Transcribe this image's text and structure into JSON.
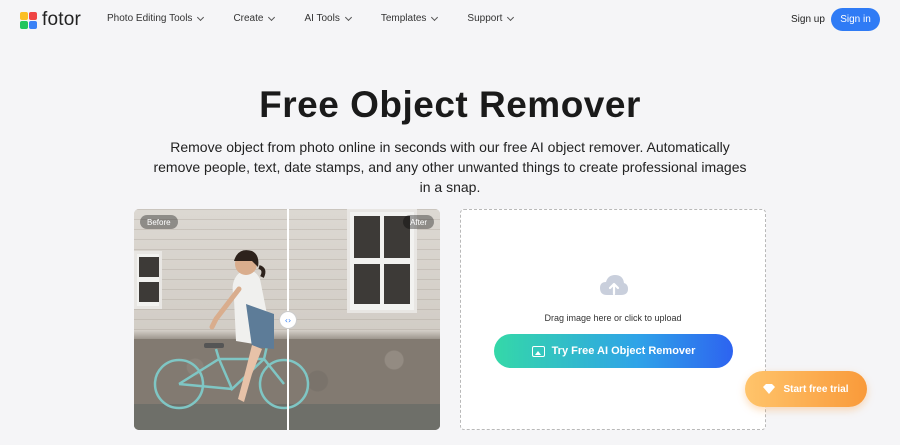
{
  "nav": {
    "logo_text": "fotor",
    "menu": [
      {
        "label": "Photo Editing Tools"
      },
      {
        "label": "Create"
      },
      {
        "label": "AI Tools"
      },
      {
        "label": "Templates"
      },
      {
        "label": "Support"
      }
    ],
    "signup_label": "Sign up",
    "signin_label": "Sign in"
  },
  "hero": {
    "title": "Free Object Remover",
    "subtitle": "Remove object from photo online in seconds with our free AI object remover. Automatically remove people, text, date stamps, and any other unwanted things to create professional images in a snap."
  },
  "compare": {
    "before_label": "Before",
    "after_label": "After",
    "handle_icon": "arrows-left-right-icon"
  },
  "upload": {
    "text": "Drag image here or click to upload",
    "icon": "cloud-upload-icon",
    "button_label": "Try Free AI Object Remover",
    "button_icon": "image-icon"
  },
  "trial": {
    "label": "Start free trial",
    "icon": "diamond-icon"
  },
  "colors": {
    "primary": "#2f7bf5",
    "trial_start": "#ffc46b",
    "trial_end": "#f99a3a",
    "try_gradient_start": "#34d8a8",
    "try_gradient_end": "#2d63f0"
  }
}
